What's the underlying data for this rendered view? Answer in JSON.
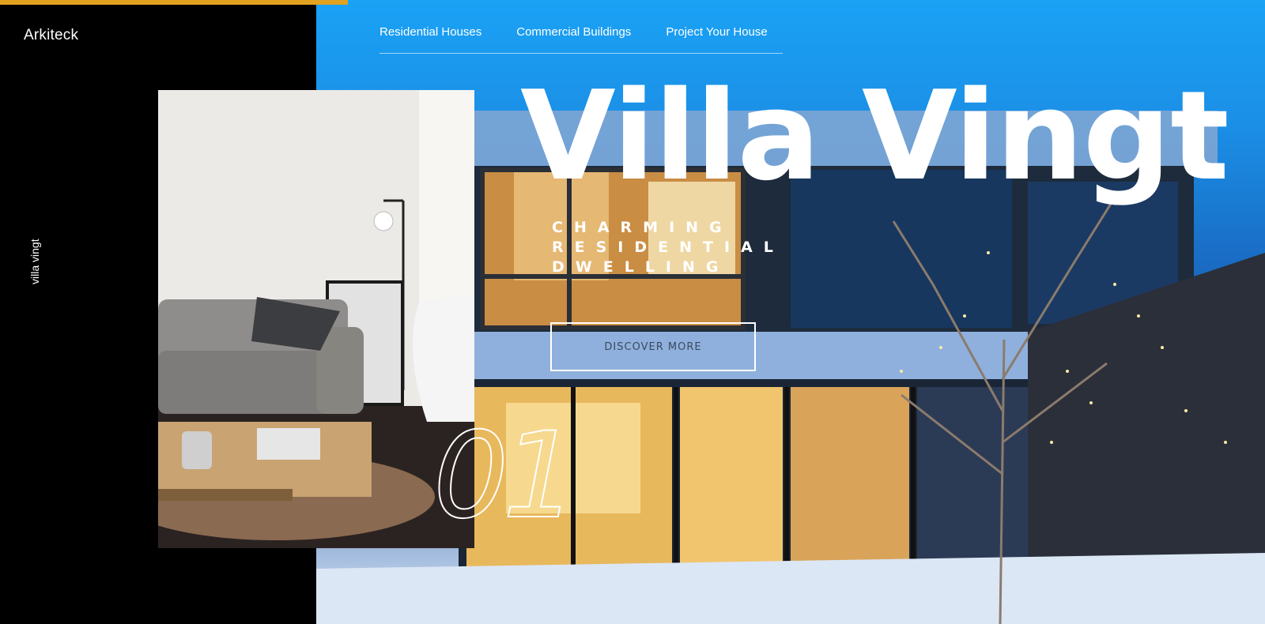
{
  "brand": {
    "name": "Arkiteck"
  },
  "sidebar": {
    "vertical_label": "villa vingt"
  },
  "nav": {
    "items": [
      {
        "label": "Residential Houses"
      },
      {
        "label": "Commercial Buildings"
      },
      {
        "label": "Project Your House"
      }
    ]
  },
  "hero": {
    "title": "Villa Vingt",
    "subtitle": "CHARMING RESIDENTIAL DWELLING",
    "cta_label": "DISCOVER MORE",
    "slide_number": "01"
  },
  "colors": {
    "accent": "#e2a21f",
    "panel": "#000000",
    "sky": "#1b8fe6"
  }
}
